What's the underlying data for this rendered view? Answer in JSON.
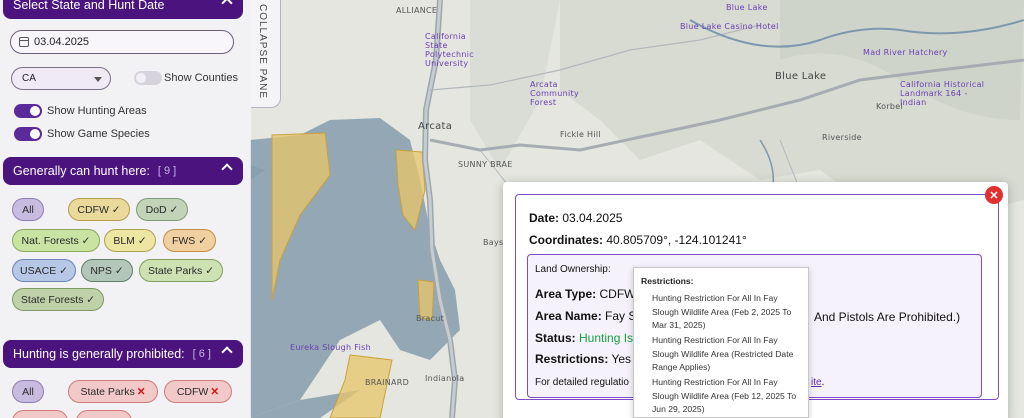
{
  "map": {
    "labels": {
      "alliance": "ALLIANCE",
      "arcata": "Arcata",
      "sunny_brae": "SUNNY BRAE",
      "fickle_hill": "Fickle Hill",
      "blue_lake": "Blue Lake",
      "korbel": "Korbel",
      "riverside": "Riverside",
      "bracut": "Bracut",
      "indianola": "Indianola",
      "bay": "Bays",
      "casino": "Blue Lake Casino Hotel",
      "cal_poly": "California State Polytechnic University",
      "arcata_community": "Arcata Community Forest",
      "mad_river_hatchery": "Mad River Hatchery",
      "cal_historical": "California Historical Landmark 164 - Indian",
      "blue_lake_poi": "Blue Lake",
      "freshwater": "Eureka Slough Fish",
      "brainard": "BRAINARD"
    },
    "colors": {
      "land": "#e4e6df",
      "water": "#93a7b5",
      "ownership_fill": "#e8c66a",
      "ownership_stroke": "#caa23c",
      "road": "#a0a7ad"
    }
  },
  "sidebar": {
    "header_title": "Select State and Hunt Date",
    "date_value": "03.04.2025",
    "state_value": "CA",
    "show_counties_label": "Show Counties",
    "show_hunting_areas_label": "Show Hunting Areas",
    "show_game_species_label": "Show Game Species",
    "can_hunt": {
      "title": "Generally can hunt here:",
      "count": "[ 9 ]",
      "chips": [
        "All",
        "CDFW ✓",
        "DoD ✓",
        "Nat. Forests ✓",
        "BLM ✓",
        "FWS ✓",
        "USACE ✓",
        "NPS ✓",
        "State Parks ✓",
        "State Forests ✓"
      ]
    },
    "prohibited": {
      "title": "Hunting is generally prohibited:",
      "count": "[ 6 ]",
      "chips": [
        "All",
        "State Parks",
        "CDFW"
      ],
      "x_glyph": "✕"
    }
  },
  "collapse_pane_label": "COLLAPSE PANE",
  "popup": {
    "close_glyph": "✕",
    "date_label": "Date:",
    "date_value": "03.04.2025",
    "coords_label": "Coordinates:",
    "coords_value": "40.805709°, -124.101241°",
    "land_ownership_label": "Land Ownership:",
    "area_type_label": "Area Type:",
    "area_type_value": "CDFW",
    "area_name_label": "Area Name:",
    "area_name_value": "Fay Sl",
    "area_name_tail": "And Pistols Are Prohibited.)",
    "status_label": "Status:",
    "status_value": "Hunting Is",
    "restrictions_label": "Restrictions:",
    "restrictions_value": "Yes",
    "regs_text": "For detailed regulatio",
    "regs_link_tail": "ite",
    "regs_period": "."
  },
  "restrictions_tooltip": {
    "title": "Restrictions:",
    "items": [
      "Hunting Restriction For All In Fay Slough Wildlife Area (Feb 2, 2025 To Mar 31, 2025)",
      "Hunting Restriction For All In Fay Slough Wildlife Area (Restricted Date Range Applies)",
      "Hunting Restriction For All In Fay Slough Wildlife Area (Feb 12, 2025 To Jun 29, 2025)"
    ]
  }
}
